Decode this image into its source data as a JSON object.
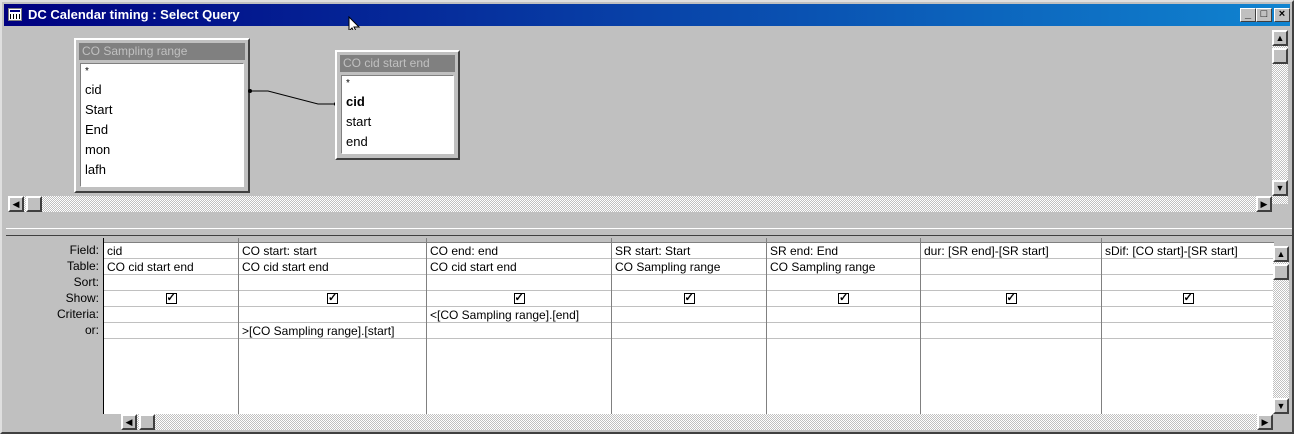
{
  "window": {
    "title": "DC Calendar timing : Select Query",
    "controls": {
      "minimize": "_",
      "maximize": "□",
      "close": "×"
    }
  },
  "tables": [
    {
      "name": "CO Sampling range",
      "fields": [
        "*",
        "cid",
        "Start",
        "End",
        "mon",
        "lafh"
      ]
    },
    {
      "name": "CO cid start end",
      "fields": [
        "*",
        "cid",
        "start",
        "end"
      ]
    }
  ],
  "grid": {
    "row_labels": [
      "Field:",
      "Table:",
      "Sort:",
      "Show:",
      "Criteria:",
      "or:"
    ],
    "columns": [
      {
        "field": "cid",
        "table": "CO cid start end",
        "sort": "",
        "show": true,
        "criteria": "",
        "or": ""
      },
      {
        "field": "CO start: start",
        "table": "CO cid start end",
        "sort": "",
        "show": true,
        "criteria": "",
        "or": ">[CO Sampling range].[start]"
      },
      {
        "field": "CO end: end",
        "table": "CO cid start end",
        "sort": "",
        "show": true,
        "criteria": "<[CO Sampling range].[end]",
        "or": ""
      },
      {
        "field": "SR start: Start",
        "table": "CO Sampling range",
        "sort": "",
        "show": true,
        "criteria": "",
        "or": ""
      },
      {
        "field": "SR end: End",
        "table": "CO Sampling range",
        "sort": "",
        "show": true,
        "criteria": "",
        "or": ""
      },
      {
        "field": "dur: [SR end]-[SR start]",
        "table": "",
        "sort": "",
        "show": true,
        "criteria": "",
        "or": ""
      },
      {
        "field": "sDif: [CO start]-[SR start]",
        "table": "",
        "sort": "",
        "show": true,
        "criteria": "",
        "or": ""
      }
    ]
  }
}
